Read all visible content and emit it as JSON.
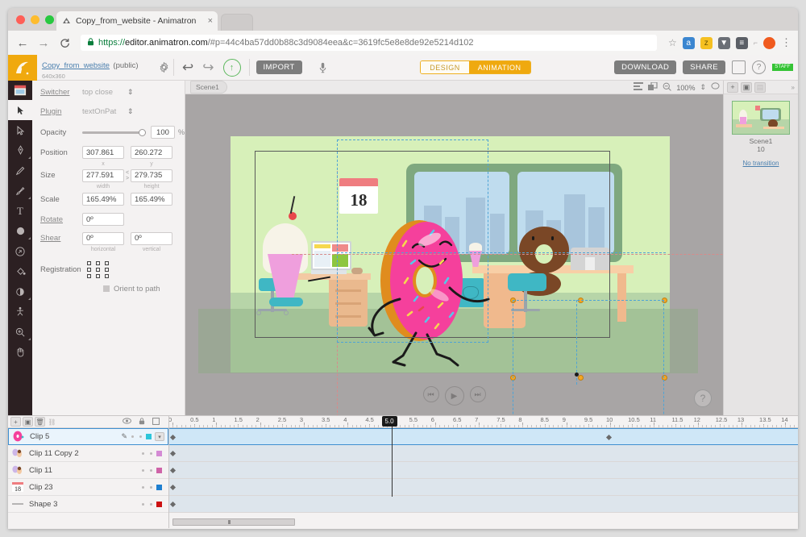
{
  "browser": {
    "tab_title": "Copy_from_website - Animatron",
    "tab_close": "×",
    "url_scheme": "https://",
    "url_domain": "editor.animatron.com",
    "url_path": "/#p=44c4ba57dd0b88c3d9084eea&c=3619fc5e8e8de92e5214d102",
    "back": "←",
    "forward": "→",
    "reload": "C",
    "star": "☆",
    "menu": "⋮"
  },
  "appbar": {
    "project_name": "Copy_from_website",
    "project_visibility": "(public)",
    "project_dimensions": "640x360",
    "import_label": "IMPORT",
    "download_label": "DOWNLOAD",
    "share_label": "SHARE",
    "mode_design": "DESIGN",
    "mode_animation": "ANIMATION",
    "avatar_badge": "STAFF"
  },
  "properties": {
    "switcher_label": "Switcher",
    "switcher_value": "top close",
    "plugin_label": "Plugin",
    "plugin_value": "textOnPat",
    "opacity_label": "Opacity",
    "opacity_value": "100",
    "opacity_unit": "%",
    "position_label": "Position",
    "position_x": "307.861",
    "position_y": "260.272",
    "position_x_sub": "x",
    "position_y_sub": "y",
    "size_label": "Size",
    "size_w": "277.591",
    "size_h": "279.735",
    "size_link": "< >",
    "size_w_sub": "width",
    "size_h_sub": "height",
    "scale_label": "Scale",
    "scale_x": "165.49%",
    "scale_y": "165.49%",
    "rotate_label": "Rotate",
    "rotate_value": "0º",
    "shear_label": "Shear",
    "shear_h": "0º",
    "shear_v": "0º",
    "shear_h_sub": "horizontal",
    "shear_v_sub": "vertical",
    "registration_label": "Registration",
    "orient_label": "Orient to path"
  },
  "toolbar_left": {
    "tools": [
      {
        "name": "select-arrow",
        "glyph": "➤"
      },
      {
        "name": "subselect-arrow",
        "glyph": "➤"
      },
      {
        "name": "pen-nib",
        "glyph": "✒"
      },
      {
        "name": "pencil",
        "glyph": "✏"
      },
      {
        "name": "brush",
        "glyph": "🖌"
      },
      {
        "name": "text",
        "glyph": "T"
      },
      {
        "name": "shape-ellipse",
        "glyph": "●"
      },
      {
        "name": "eraser",
        "glyph": "⊘"
      },
      {
        "name": "paint-bucket",
        "glyph": "◍"
      },
      {
        "name": "eyedropper",
        "glyph": "◑"
      },
      {
        "name": "bone-rig",
        "glyph": "⚘"
      },
      {
        "name": "zoom",
        "glyph": "⊕"
      },
      {
        "name": "hand",
        "glyph": "✋"
      }
    ]
  },
  "canvas": {
    "scene_tab": "Scene1",
    "zoom_level": "100%",
    "calendar_day": "18",
    "play_prev": "⏮",
    "play": "▶",
    "play_next": "⏭",
    "help": "?"
  },
  "scenes": {
    "card_name": "Scene1",
    "card_duration": "10",
    "transition": "No transition"
  },
  "timeline": {
    "header_eye": "👁",
    "header_lock": "🔒",
    "header_box": "▢",
    "layers": [
      {
        "name": "Clip 5",
        "color": "#2ec6da",
        "selected": true,
        "thumb": "pink-donut"
      },
      {
        "name": "Clip 11 Copy 2",
        "color": "#d48ad4",
        "selected": false,
        "thumb": "character"
      },
      {
        "name": "Clip 11",
        "color": "#cf63a8",
        "selected": false,
        "thumb": "character"
      },
      {
        "name": "Clip 23",
        "color": "#1f7fd0",
        "selected": false,
        "thumb": "calendar-18"
      },
      {
        "name": "Shape 3",
        "color": "#cc1111",
        "selected": false,
        "thumb": "line"
      }
    ],
    "ruler_ticks": [
      "0",
      "0.5",
      "1",
      "1.5",
      "2",
      "2.5",
      "3",
      "3.5",
      "4",
      "4.5",
      "5.0",
      "5.5",
      "6",
      "6.5",
      "7",
      "7.5",
      "8",
      "8.5",
      "9",
      "9.5",
      "10",
      "10.5",
      "11",
      "11.5",
      "12",
      "12.5",
      "13",
      "13.5",
      "14"
    ],
    "current_time": "5.0",
    "playhead_time": 5.0
  }
}
